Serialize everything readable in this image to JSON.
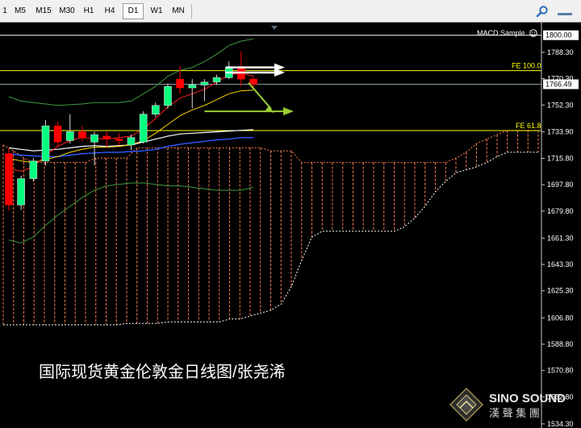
{
  "toolbar": {
    "timeframes": [
      "1",
      "M5",
      "M15",
      "M30",
      "H1",
      "H4",
      "D1",
      "W1",
      "MN"
    ],
    "active": "D1"
  },
  "chart": {
    "indicator_label": "MACD Sample",
    "current_price": "1766.49",
    "fe_labels": {
      "fe100": "FE 100.0",
      "fe618": "FE 61.8"
    },
    "price_axis": [
      "1800.00",
      "1788.30",
      "1770.30",
      "1752.30",
      "1733.90",
      "1715.80",
      "1697.80",
      "1679.80",
      "1661.30",
      "1643.30",
      "1625.30",
      "1606.80",
      "1588.80",
      "1570.80",
      "1552.80",
      "1534.30"
    ],
    "caption": "国际现货黄金伦敦金日线图/张尧浠",
    "watermark": {
      "brand": "SINO SOUND",
      "cjk": "漢 聲 集 團"
    },
    "colors": {
      "bull": "#00ff7f",
      "bear": "#ff0000",
      "cloud": "#ff7f50",
      "fe_line": "#ffff00",
      "arrow_green": "#9acd32",
      "text_yellow": "#ffff00"
    }
  },
  "chart_data": {
    "type": "candlestick",
    "symbol_timeframe": "D1",
    "price_ticks": [
      1800.0,
      1788.3,
      1770.3,
      1752.3,
      1733.9,
      1715.8,
      1697.8,
      1679.8,
      1661.3,
      1643.3,
      1625.3,
      1606.8,
      1588.8,
      1570.8,
      1552.8,
      1534.3
    ],
    "ylim": [
      1529,
      1805
    ],
    "current_price": 1766.49,
    "levels": {
      "fe100": 1775.8,
      "fe618": 1734.8,
      "top_line": 1800.0
    },
    "candles": [
      {
        "o": 1719.0,
        "h": 1723.0,
        "l": 1680.0,
        "c": 1684.0
      },
      {
        "o": 1684.0,
        "h": 1704.0,
        "l": 1680.5,
        "c": 1702.0
      },
      {
        "o": 1702.0,
        "h": 1716.0,
        "l": 1700.0,
        "c": 1714.0
      },
      {
        "o": 1714.0,
        "h": 1742.0,
        "l": 1711.0,
        "c": 1738.0
      },
      {
        "o": 1738.0,
        "h": 1741.0,
        "l": 1724.0,
        "c": 1727.0
      },
      {
        "o": 1728.0,
        "h": 1746.0,
        "l": 1726.0,
        "c": 1734.0
      },
      {
        "o": 1734.0,
        "h": 1738.0,
        "l": 1727.5,
        "c": 1730.0
      },
      {
        "o": 1727.0,
        "h": 1734.0,
        "l": 1711.0,
        "c": 1732.0
      },
      {
        "o": 1731.0,
        "h": 1734.0,
        "l": 1723.5,
        "c": 1729.0
      },
      {
        "o": 1729.0,
        "h": 1733.0,
        "l": 1725.0,
        "c": 1728.0
      },
      {
        "o": 1725.0,
        "h": 1732.0,
        "l": 1721.5,
        "c": 1730.0
      },
      {
        "o": 1727.0,
        "h": 1748.0,
        "l": 1726.0,
        "c": 1746.0
      },
      {
        "o": 1746.0,
        "h": 1754.0,
        "l": 1744.0,
        "c": 1752.0
      },
      {
        "o": 1752.0,
        "h": 1767.0,
        "l": 1750.0,
        "c": 1765.0
      },
      {
        "o": 1770.0,
        "h": 1779.0,
        "l": 1760.0,
        "c": 1764.0
      },
      {
        "o": 1764.0,
        "h": 1770.0,
        "l": 1750.0,
        "c": 1766.0
      },
      {
        "o": 1766.0,
        "h": 1770.0,
        "l": 1755.0,
        "c": 1768.0
      },
      {
        "o": 1768.0,
        "h": 1773.0,
        "l": 1766.0,
        "c": 1771.0
      },
      {
        "o": 1771.0,
        "h": 1782.0,
        "l": 1770.0,
        "c": 1778.0
      },
      {
        "o": 1778.0,
        "h": 1789.0,
        "l": 1765.0,
        "c": 1770.0
      },
      {
        "o": 1770.0,
        "h": 1772.0,
        "l": 1764.0,
        "c": 1766.5
      }
    ],
    "ma_fast": [
      1709,
      1707,
      1710,
      1718,
      1724,
      1728,
      1730,
      1729.5,
      1729,
      1730,
      1731,
      1736,
      1743,
      1751,
      1757,
      1760,
      1763,
      1768,
      1773,
      1774,
      1772
    ],
    "ma_slow": [
      1716,
      1714,
      1713,
      1715,
      1717,
      1720,
      1722,
      1723.5,
      1723.5,
      1724,
      1725,
      1728,
      1733,
      1739,
      1745,
      1749,
      1752,
      1756,
      1760,
      1762,
      1762.5
    ],
    "ma_white": [
      1723,
      1722,
      1721,
      1721.5,
      1722,
      1723,
      1724,
      1724.5,
      1724,
      1724.5,
      1725,
      1727,
      1729,
      1731,
      1732.5,
      1733,
      1733.5,
      1734,
      1734.5,
      1735,
      1735.5
    ],
    "ma_blue": [
      1719,
      1718,
      1717.5,
      1717,
      1717,
      1718,
      1719,
      1719.5,
      1720,
      1720,
      1720.5,
      1721,
      1722,
      1724,
      1725.5,
      1726.5,
      1727.5,
      1728.5,
      1729,
      1730,
      1730
    ],
    "bb_upper": [
      1758,
      1755,
      1754,
      1753,
      1752,
      1752.5,
      1753,
      1754,
      1754,
      1754,
      1755,
      1760,
      1765,
      1772,
      1776,
      1778,
      1782,
      1787,
      1793,
      1796,
      1797.5
    ],
    "bb_lower": [
      1660,
      1658,
      1662,
      1670,
      1677,
      1683,
      1689,
      1694,
      1697,
      1698,
      1699,
      1699,
      1698,
      1697,
      1697,
      1696,
      1695,
      1694,
      1694,
      1694,
      1696
    ],
    "cloud": [
      {
        "top": 1725,
        "bottom": 1602
      },
      {
        "top": 1721,
        "bottom": 1602
      },
      {
        "top": 1716,
        "bottom": 1602
      },
      {
        "top": 1713,
        "bottom": 1602
      },
      {
        "top": 1713,
        "bottom": 1602
      },
      {
        "top": 1713,
        "bottom": 1602
      },
      {
        "top": 1713,
        "bottom": 1602
      },
      {
        "top": 1713,
        "bottom": 1602
      },
      {
        "top": 1713,
        "bottom": 1602
      },
      {
        "top": 1716,
        "bottom": 1602
      },
      {
        "top": 1716,
        "bottom": 1602
      },
      {
        "top": 1716,
        "bottom": 1602
      },
      {
        "top": 1716,
        "bottom": 1603
      },
      {
        "top": 1723,
        "bottom": 1603
      },
      {
        "top": 1723,
        "bottom": 1603
      },
      {
        "top": 1723,
        "bottom": 1603
      },
      {
        "top": 1723,
        "bottom": 1604
      },
      {
        "top": 1723,
        "bottom": 1604
      },
      {
        "top": 1723,
        "bottom": 1604
      },
      {
        "top": 1723,
        "bottom": 1604
      },
      {
        "top": 1723,
        "bottom": 1604
      },
      {
        "top": 1723,
        "bottom": 1604
      },
      {
        "top": 1723,
        "bottom": 1606
      },
      {
        "top": 1723,
        "bottom": 1606
      },
      {
        "top": 1723,
        "bottom": 1608
      },
      {
        "top": 1723,
        "bottom": 1610
      },
      {
        "top": 1721,
        "bottom": 1612
      },
      {
        "top": 1721,
        "bottom": 1616
      },
      {
        "top": 1721,
        "bottom": 1628
      },
      {
        "top": 1713,
        "bottom": 1646
      },
      {
        "top": 1713,
        "bottom": 1662
      },
      {
        "top": 1713,
        "bottom": 1666
      },
      {
        "top": 1713,
        "bottom": 1666
      },
      {
        "top": 1713,
        "bottom": 1666
      },
      {
        "top": 1713,
        "bottom": 1666
      },
      {
        "top": 1713,
        "bottom": 1666
      },
      {
        "top": 1713,
        "bottom": 1666
      },
      {
        "top": 1713,
        "bottom": 1666
      },
      {
        "top": 1713,
        "bottom": 1666
      },
      {
        "top": 1713,
        "bottom": 1669
      },
      {
        "top": 1713,
        "bottom": 1675
      },
      {
        "top": 1713,
        "bottom": 1683
      },
      {
        "top": 1713,
        "bottom": 1693
      },
      {
        "top": 1713,
        "bottom": 1700
      },
      {
        "top": 1716,
        "bottom": 1706
      },
      {
        "top": 1720,
        "bottom": 1708
      },
      {
        "top": 1726,
        "bottom": 1710
      },
      {
        "top": 1729,
        "bottom": 1713
      },
      {
        "top": 1732,
        "bottom": 1717
      },
      {
        "top": 1735,
        "bottom": 1720
      },
      {
        "top": 1735,
        "bottom": 1720
      },
      {
        "top": 1735,
        "bottom": 1720
      },
      {
        "top": 1735,
        "bottom": 1720
      }
    ],
    "arrows": [
      {
        "color": "white",
        "price": 1778.0
      },
      {
        "color": "white",
        "price": 1774.5
      },
      {
        "color": "green",
        "price": 1748.0,
        "from_price": 1767.5
      }
    ]
  }
}
